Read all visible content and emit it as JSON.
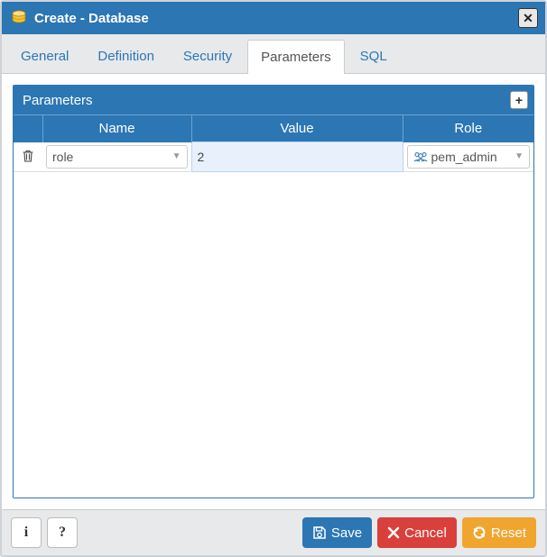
{
  "window": {
    "title": "Create - Database",
    "close_label": "✕"
  },
  "tabs": {
    "general": "General",
    "definition": "Definition",
    "security": "Security",
    "parameters": "Parameters",
    "sql": "SQL",
    "active": "parameters"
  },
  "panel": {
    "title": "Parameters",
    "add_label": "+",
    "columns": {
      "name": "Name",
      "value": "Value",
      "role": "Role"
    },
    "rows": [
      {
        "name": "role",
        "value": "2",
        "role": "pem_admin"
      }
    ]
  },
  "footer": {
    "info_label": "i",
    "help_label": "?",
    "save_label": "Save",
    "cancel_label": "Cancel",
    "reset_label": "Reset"
  }
}
